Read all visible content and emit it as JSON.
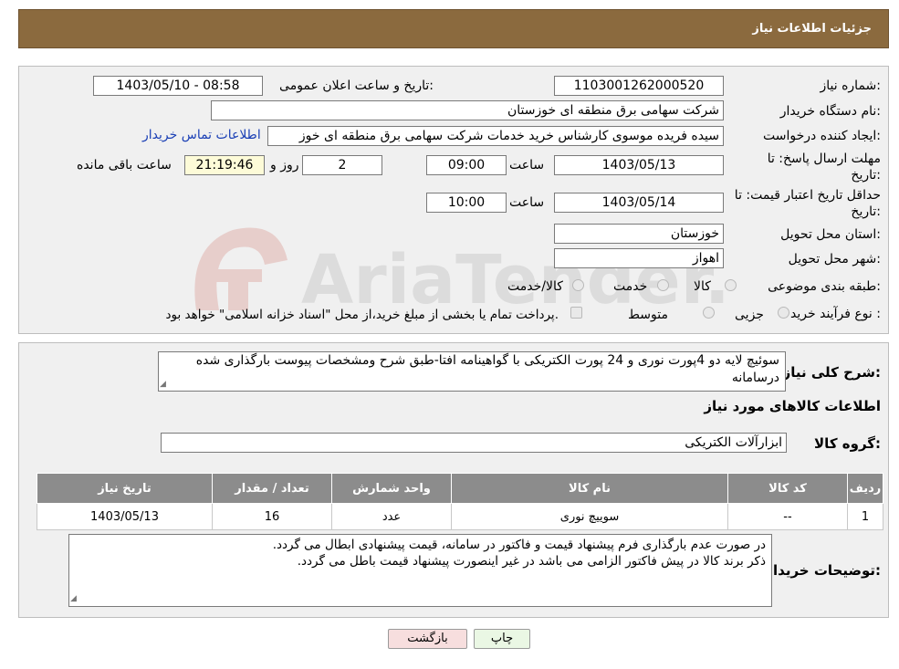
{
  "header": {
    "title": "جزئیات اطلاعات نیاز"
  },
  "watermark": {
    "text": "AriaTender.neT"
  },
  "form": {
    "need_number": {
      "label": "شماره نیاز:",
      "value": "1103001262000520"
    },
    "announce": {
      "label": "تاریخ و ساعت اعلان عمومی:",
      "value": "1403/05/10 - 08:58"
    },
    "buyer_org": {
      "label": "نام دستگاه خریدار:",
      "value": "شرکت سهامی برق منطقه ای خوزستان"
    },
    "requester": {
      "label": "ایجاد کننده درخواست:",
      "value": "سیده فریده موسوی کارشناس خرید خدمات شرکت سهامی برق منطقه ای خوز",
      "contact_link": "اطلاعات تماس خریدار"
    },
    "deadline": {
      "label_line1": "مهلت ارسال پاسخ: تا",
      "label_line2": "تاریخ:",
      "date": "1403/05/13",
      "time_label": "ساعت",
      "time": "09:00",
      "days": "2",
      "days_label": "روز و",
      "remaining": "21:19:46",
      "remaining_label": "ساعت باقی مانده"
    },
    "price_validity": {
      "label_line1": "حداقل تاریخ اعتبار قیمت: تا",
      "label_line2": "تاریخ:",
      "date": "1403/05/14",
      "time_label": "ساعت",
      "time": "10:00"
    },
    "province": {
      "label": "استان محل تحویل:",
      "value": "خوزستان"
    },
    "city": {
      "label": "شهر محل تحویل:",
      "value": "اهواز"
    },
    "category": {
      "label": "طبقه بندی موضوعی:",
      "options": [
        "کالا",
        "خدمت",
        "کالا/خدمت"
      ]
    },
    "process": {
      "label": "نوع فرآیند خرید :",
      "options": [
        "جزیی",
        "متوسط"
      ],
      "note": "پرداخت تمام یا بخشی از مبلغ خرید،از محل \"اسناد خزانه اسلامی\" خواهد بود."
    }
  },
  "details": {
    "summary_label": "شرح کلی نیاز:",
    "summary": "سوئیچ لایه دو 4پورت نوری و 24 پورت الکتریکی با گواهینامه افتا-طبق شرح ومشخصات پیوست بارگذاری شده درسامانه",
    "goods_info_title": "اطلاعات کالاهای مورد نیاز",
    "group_label": "گروه کالا:",
    "group_value": "ابزارآلات الکتریکی",
    "table": {
      "headers": [
        "ردیف",
        "کد کالا",
        "نام کالا",
        "واحد شمارش",
        "تعداد / مقدار",
        "تاریخ نیاز"
      ],
      "rows": [
        [
          "1",
          "--",
          "سوییچ نوری",
          "عدد",
          "16",
          "1403/05/13"
        ]
      ]
    },
    "buyer_notes_label": "توضیحات خریدار:",
    "buyer_notes_line1": "در صورت عدم بارگذاری فرم پیشنهاد قیمت و فاکتور در سامانه، قیمت پیشنهادی ابطال می گردد.",
    "buyer_notes_line2": "ذکر برند کالا در پیش فاکتور الزامی می باشد در غیر اینصورت پیشنهاد قیمت باطل می گردد."
  },
  "buttons": {
    "print": "چاپ",
    "back": "بازگشت"
  },
  "colors": {
    "header_bg": "#8b6a3e",
    "link": "#1a3fb5",
    "table_header": "#8c8c8c",
    "back_button_bg": "#f7dede",
    "print_button_bg": "#eaf7e4"
  }
}
